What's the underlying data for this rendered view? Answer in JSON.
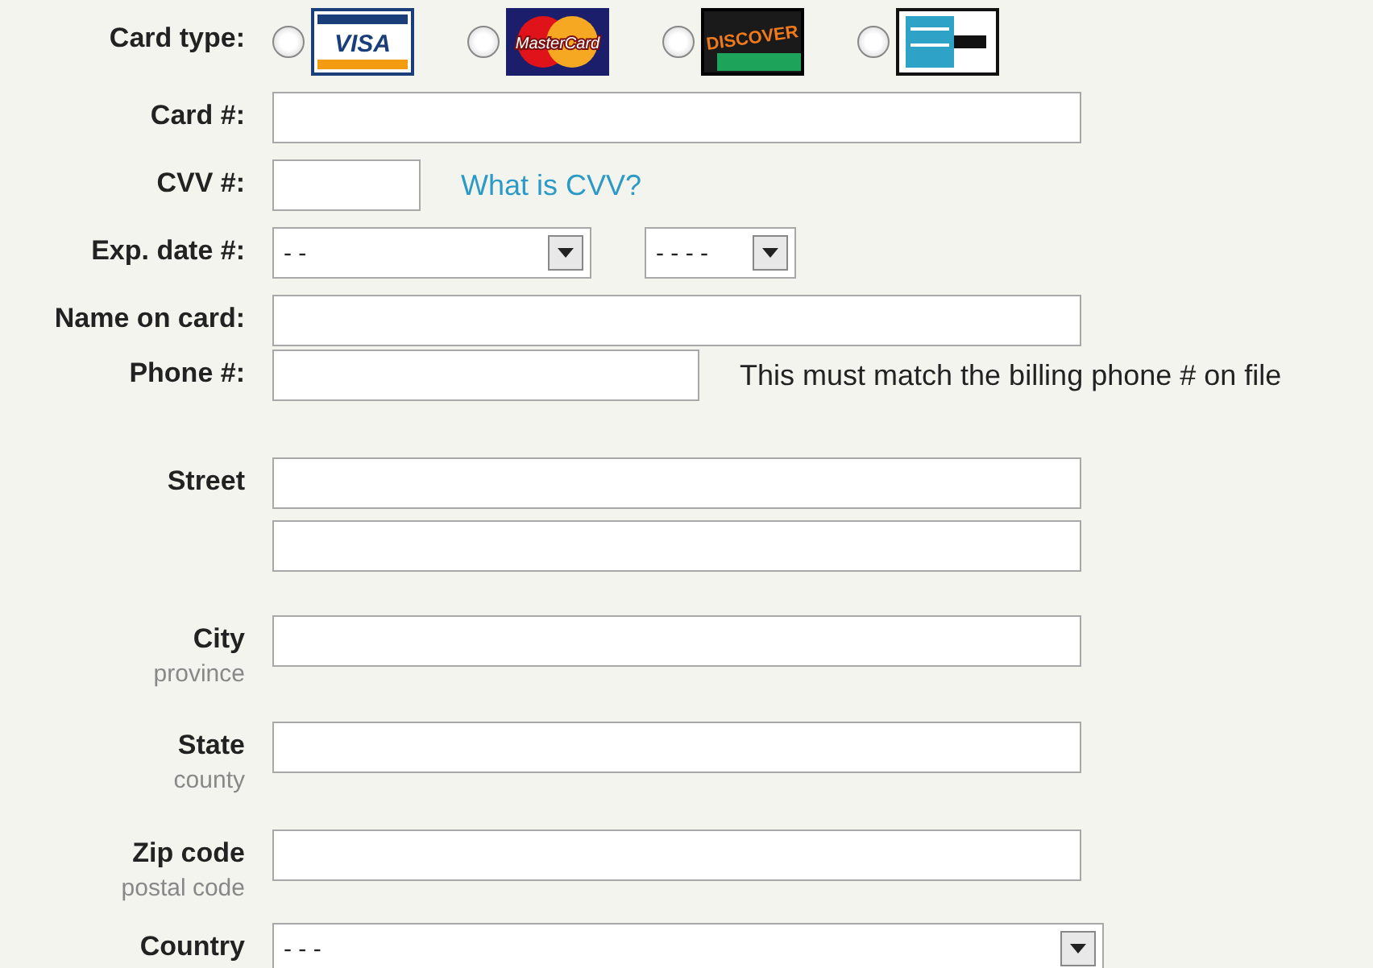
{
  "card_type": {
    "label": "Card type:",
    "options": [
      {
        "kind": "visa",
        "text": "VISA",
        "selected": false
      },
      {
        "kind": "mastercard",
        "text": "MasterCard",
        "selected": false
      },
      {
        "kind": "discover",
        "text": "DISCOVER",
        "selected": false
      },
      {
        "kind": "amex",
        "selected": false
      }
    ]
  },
  "card_number": {
    "label": "Card #:"
  },
  "cvv": {
    "label": "CVV #:",
    "link": "What is CVV?"
  },
  "exp_date": {
    "label": "Exp. date #:",
    "month": "- -",
    "year": "- - - -"
  },
  "name_on_card": {
    "label": "Name on card:"
  },
  "phone": {
    "label": "Phone #:",
    "note": "This must match the billing phone # on file"
  },
  "street": {
    "label": "Street"
  },
  "city": {
    "label": "City",
    "sublabel": "province"
  },
  "state": {
    "label": "State",
    "sublabel": "county"
  },
  "zip": {
    "label": "Zip code",
    "sublabel": "postal code"
  },
  "country": {
    "label": "Country",
    "value": "- - -"
  }
}
